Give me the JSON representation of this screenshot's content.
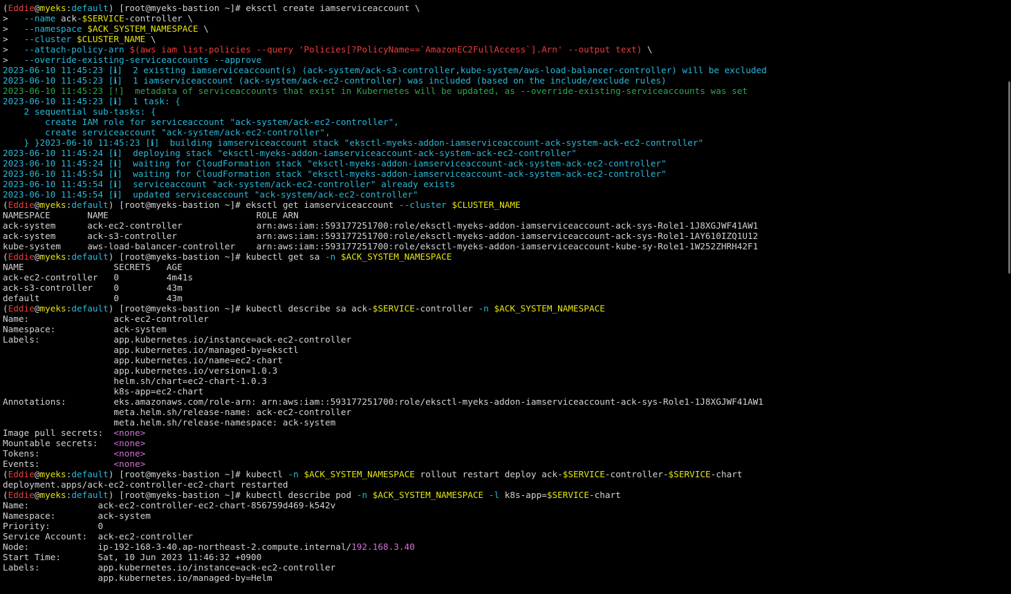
{
  "colors": {
    "default": "#d4d4d4",
    "red": "#ee3b3b",
    "yellow": "#e5e510",
    "cyan": "#29b8db",
    "blue": "#3b8eea",
    "green": "#23d18b",
    "dim_green": "#2aa84a",
    "magenta": "#d670d6"
  },
  "lines": [
    [
      [
        "(",
        "default"
      ],
      [
        "Eddie",
        "red"
      ],
      [
        "@",
        "default"
      ],
      [
        "myeks",
        "yellow"
      ],
      [
        ":",
        "default"
      ],
      [
        "default",
        "cyan"
      ],
      [
        ") [root@myeks-bastion ~]# eksctl create iamserviceaccount \\",
        "default"
      ]
    ],
    [
      [
        ">   ",
        "default"
      ],
      [
        "--name",
        "cyan"
      ],
      [
        " ack-",
        "default"
      ],
      [
        "$SERVICE",
        "yellow"
      ],
      [
        "-controller \\",
        "default"
      ]
    ],
    [
      [
        ">   ",
        "default"
      ],
      [
        "--namespace",
        "cyan"
      ],
      [
        " ",
        "default"
      ],
      [
        "$ACK_SYSTEM_NAMESPACE",
        "yellow"
      ],
      [
        " \\",
        "default"
      ]
    ],
    [
      [
        ">   ",
        "default"
      ],
      [
        "--cluster",
        "cyan"
      ],
      [
        " ",
        "default"
      ],
      [
        "$CLUSTER_NAME",
        "yellow"
      ],
      [
        " \\",
        "default"
      ]
    ],
    [
      [
        ">   ",
        "default"
      ],
      [
        "--attach-policy-arn",
        "cyan"
      ],
      [
        " ",
        "default"
      ],
      [
        "$(aws iam list-policies --query 'Policies[?PolicyName==`AmazonEC2FullAccess`].Arn' --output text)",
        "red"
      ],
      [
        " \\",
        "default"
      ]
    ],
    [
      [
        ">   ",
        "default"
      ],
      [
        "--override-existing-serviceaccounts",
        "cyan"
      ],
      [
        " ",
        "default"
      ],
      [
        "--approve",
        "cyan"
      ]
    ],
    [
      [
        "2023-06-10 11:45:23 [ℹ]  2 existing iamserviceaccount(s) (ack-system/ack-s3-controller,kube-system/aws-load-balancer-controller) will be excluded",
        "cyan"
      ]
    ],
    [
      [
        "2023-06-10 11:45:23 [ℹ]  1 iamserviceaccount (ack-system/ack-ec2-controller) was included (based on the include/exclude rules)",
        "cyan"
      ]
    ],
    [
      [
        "2023-06-10 11:45:23 [!]  metadata of serviceaccounts that exist in Kubernetes will be updated, as --override-existing-serviceaccounts was set",
        "dim_green"
      ]
    ],
    [
      [
        "2023-06-10 11:45:23 [ℹ]  1 task: {",
        "cyan"
      ]
    ],
    [
      [
        "    2 sequential sub-tasks: {",
        "cyan"
      ]
    ],
    [
      [
        "        create IAM role for serviceaccount \"ack-system/ack-ec2-controller\",",
        "cyan"
      ]
    ],
    [
      [
        "        create serviceaccount \"ack-system/ack-ec2-controller\",",
        "cyan"
      ]
    ],
    [
      [
        "    } }2023-06-10 11:45:23 [ℹ]  building iamserviceaccount stack \"eksctl-myeks-addon-iamserviceaccount-ack-system-ack-ec2-controller\"",
        "cyan"
      ]
    ],
    [
      [
        "2023-06-10 11:45:24 [ℹ]  deploying stack \"eksctl-myeks-addon-iamserviceaccount-ack-system-ack-ec2-controller\"",
        "cyan"
      ]
    ],
    [
      [
        "2023-06-10 11:45:24 [ℹ]  waiting for CloudFormation stack \"eksctl-myeks-addon-iamserviceaccount-ack-system-ack-ec2-controller\"",
        "cyan"
      ]
    ],
    [
      [
        "2023-06-10 11:45:54 [ℹ]  waiting for CloudFormation stack \"eksctl-myeks-addon-iamserviceaccount-ack-system-ack-ec2-controller\"",
        "cyan"
      ]
    ],
    [
      [
        "2023-06-10 11:45:54 [ℹ]  serviceaccount \"ack-system/ack-ec2-controller\" already exists",
        "cyan"
      ]
    ],
    [
      [
        "2023-06-10 11:45:54 [ℹ]  updated serviceaccount \"ack-system/ack-ec2-controller\"",
        "cyan"
      ]
    ],
    [
      [
        "(",
        "default"
      ],
      [
        "Eddie",
        "red"
      ],
      [
        "@",
        "default"
      ],
      [
        "myeks",
        "yellow"
      ],
      [
        ":",
        "default"
      ],
      [
        "default",
        "cyan"
      ],
      [
        ") [root@myeks-bastion ~]# eksctl get iamserviceaccount ",
        "default"
      ],
      [
        "--cluster",
        "cyan"
      ],
      [
        " ",
        "default"
      ],
      [
        "$CLUSTER_NAME",
        "yellow"
      ]
    ],
    [
      [
        "NAMESPACE       NAME                            ROLE ARN",
        "default"
      ]
    ],
    [
      [
        "ack-system      ack-ec2-controller              arn:aws:iam::593177251700:role/eksctl-myeks-addon-iamserviceaccount-ack-sys-Role1-1J8XGJWF41AW1",
        "default"
      ]
    ],
    [
      [
        "ack-system      ack-s3-controller               arn:aws:iam::593177251700:role/eksctl-myeks-addon-iamserviceaccount-ack-sys-Role1-1AY610IZQ1U12",
        "default"
      ]
    ],
    [
      [
        "kube-system     aws-load-balancer-controller    arn:aws:iam::593177251700:role/eksctl-myeks-addon-iamserviceaccount-kube-sy-Role1-1W252ZHRH42F1",
        "default"
      ]
    ],
    [
      [
        "(",
        "default"
      ],
      [
        "Eddie",
        "red"
      ],
      [
        "@",
        "default"
      ],
      [
        "myeks",
        "yellow"
      ],
      [
        ":",
        "default"
      ],
      [
        "default",
        "cyan"
      ],
      [
        ") [root@myeks-bastion ~]# kubectl get sa ",
        "default"
      ],
      [
        "-n",
        "cyan"
      ],
      [
        " ",
        "default"
      ],
      [
        "$ACK_SYSTEM_NAMESPACE",
        "yellow"
      ]
    ],
    [
      [
        "NAME                 SECRETS   AGE",
        "default"
      ]
    ],
    [
      [
        "ack-ec2-controller   0         4m41s",
        "default"
      ]
    ],
    [
      [
        "ack-s3-controller    0         43m",
        "default"
      ]
    ],
    [
      [
        "default              0         43m",
        "default"
      ]
    ],
    [
      [
        "(",
        "default"
      ],
      [
        "Eddie",
        "red"
      ],
      [
        "@",
        "default"
      ],
      [
        "myeks",
        "yellow"
      ],
      [
        ":",
        "default"
      ],
      [
        "default",
        "cyan"
      ],
      [
        ") [root@myeks-bastion ~]# kubectl describe sa ack-",
        "default"
      ],
      [
        "$SERVICE",
        "yellow"
      ],
      [
        "-controller ",
        "default"
      ],
      [
        "-n",
        "cyan"
      ],
      [
        " ",
        "default"
      ],
      [
        "$ACK_SYSTEM_NAMESPACE",
        "yellow"
      ]
    ],
    [
      [
        "Name:                ack-ec2-controller",
        "default"
      ]
    ],
    [
      [
        "Namespace:           ack-system",
        "default"
      ]
    ],
    [
      [
        "Labels:              app.kubernetes.io/instance=ack-ec2-controller",
        "default"
      ]
    ],
    [
      [
        "                     app.kubernetes.io/managed-by=eksctl",
        "default"
      ]
    ],
    [
      [
        "                     app.kubernetes.io/name=ec2-chart",
        "default"
      ]
    ],
    [
      [
        "                     app.kubernetes.io/version=1.0.3",
        "default"
      ]
    ],
    [
      [
        "                     helm.sh/chart=ec2-chart-1.0.3",
        "default"
      ]
    ],
    [
      [
        "                     k8s-app=ec2-chart",
        "default"
      ]
    ],
    [
      [
        "Annotations:         eks.amazonaws.com/role-arn: arn:aws:iam::593177251700:role/eksctl-myeks-addon-iamserviceaccount-ack-sys-Role1-1J8XGJWF41AW1",
        "default"
      ]
    ],
    [
      [
        "                     meta.helm.sh/release-name: ack-ec2-controller",
        "default"
      ]
    ],
    [
      [
        "                     meta.helm.sh/release-namespace: ack-system",
        "default"
      ]
    ],
    [
      [
        "Image pull secrets:  ",
        "default"
      ],
      [
        "<none>",
        "magenta"
      ]
    ],
    [
      [
        "Mountable secrets:   ",
        "default"
      ],
      [
        "<none>",
        "magenta"
      ]
    ],
    [
      [
        "Tokens:              ",
        "default"
      ],
      [
        "<none>",
        "magenta"
      ]
    ],
    [
      [
        "Events:              ",
        "default"
      ],
      [
        "<none>",
        "magenta"
      ]
    ],
    [
      [
        "(",
        "default"
      ],
      [
        "Eddie",
        "red"
      ],
      [
        "@",
        "default"
      ],
      [
        "myeks",
        "yellow"
      ],
      [
        ":",
        "default"
      ],
      [
        "default",
        "cyan"
      ],
      [
        ") [root@myeks-bastion ~]# kubectl ",
        "default"
      ],
      [
        "-n",
        "cyan"
      ],
      [
        " ",
        "default"
      ],
      [
        "$ACK_SYSTEM_NAMESPACE",
        "yellow"
      ],
      [
        " rollout restart deploy ack-",
        "default"
      ],
      [
        "$SERVICE",
        "yellow"
      ],
      [
        "-controller-",
        "default"
      ],
      [
        "$SERVICE",
        "yellow"
      ],
      [
        "-chart",
        "default"
      ]
    ],
    [
      [
        "deployment.apps/ack-ec2-controller-ec2-chart restarted",
        "default"
      ]
    ],
    [
      [
        "(",
        "default"
      ],
      [
        "Eddie",
        "red"
      ],
      [
        "@",
        "default"
      ],
      [
        "myeks",
        "yellow"
      ],
      [
        ":",
        "default"
      ],
      [
        "default",
        "cyan"
      ],
      [
        ") [root@myeks-bastion ~]# kubectl describe pod ",
        "default"
      ],
      [
        "-n",
        "cyan"
      ],
      [
        " ",
        "default"
      ],
      [
        "$ACK_SYSTEM_NAMESPACE",
        "yellow"
      ],
      [
        " ",
        "default"
      ],
      [
        "-l",
        "cyan"
      ],
      [
        " k8s-app=",
        "default"
      ],
      [
        "$SERVICE",
        "yellow"
      ],
      [
        "-chart",
        "default"
      ]
    ],
    [
      [
        "Name:             ack-ec2-controller-ec2-chart-856759d469-k542v",
        "default"
      ]
    ],
    [
      [
        "Namespace:        ack-system",
        "default"
      ]
    ],
    [
      [
        "Priority:         0",
        "default"
      ]
    ],
    [
      [
        "Service Account:  ack-ec2-controller",
        "default"
      ]
    ],
    [
      [
        "Node:             ip-192-168-3-40.ap-northeast-2.compute.internal/",
        "default"
      ],
      [
        "192.168.3.40",
        "magenta"
      ]
    ],
    [
      [
        "Start Time:       Sat, 10 Jun 2023 11:46:32 +0900",
        "default"
      ]
    ],
    [
      [
        "Labels:           app.kubernetes.io/instance=ack-ec2-controller",
        "default"
      ]
    ],
    [
      [
        "                  app.kubernetes.io/managed-by=Helm",
        "default"
      ]
    ]
  ]
}
